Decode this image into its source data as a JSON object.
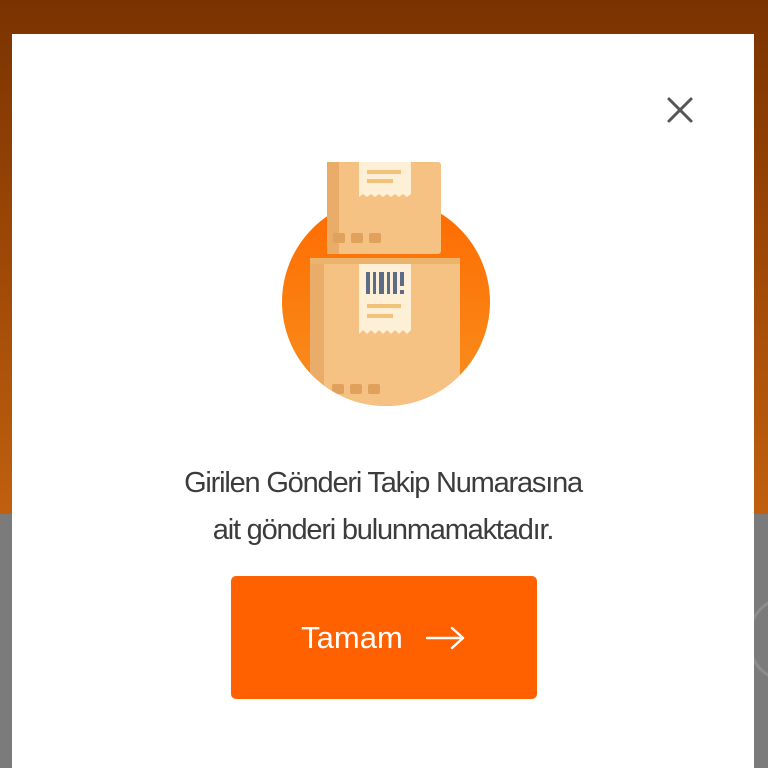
{
  "dialog": {
    "message_line1": "Girilen Gönderi Takip Numarasına",
    "message_line2": "ait gönderi bulunmamaktadır.",
    "ok_button_label": "Tamam",
    "close_icon": "close-icon",
    "illustration_icon": "package-boxes-icon",
    "button_arrow_icon": "arrow-right-icon"
  },
  "colors": {
    "accent": "#ff6000",
    "backdrop_top": "#a14a08",
    "backdrop_bottom": "#7b7b7b",
    "text": "#3c3c3c"
  }
}
